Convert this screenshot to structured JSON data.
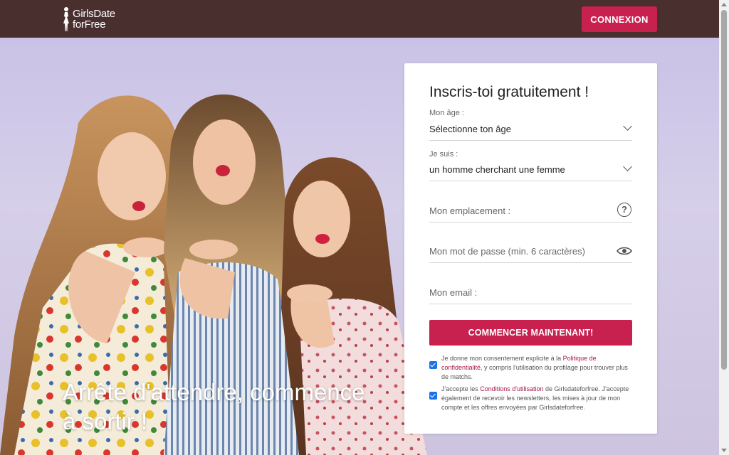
{
  "header": {
    "logo_line1": "GirlsDate",
    "logo_line2": "forFree",
    "login_label": "CONNEXION"
  },
  "hero": {
    "tagline_line1": "Arrête d'attendre, commence",
    "tagline_line2": "à sortir !"
  },
  "form": {
    "title": "Inscris-toi gratuitement !",
    "age": {
      "label": "Mon âge :",
      "value": "Sélectionne ton âge"
    },
    "seeking": {
      "label": "Je suis :",
      "value": "un homme cherchant une femme"
    },
    "location": {
      "placeholder": "Mon emplacement :"
    },
    "password": {
      "placeholder": "Mon mot de passe (min. 6 caractères)"
    },
    "email": {
      "placeholder": "Mon email :"
    },
    "submit_label": "COMMENCER MAINTENANT!",
    "consent1": {
      "checked": true,
      "text_before": "Je donne mon consentement explicite à la ",
      "link": "Politique de confidentialité",
      "text_after": ", y compris l'utilisation du profilage pour trouver plus de matchs."
    },
    "consent2": {
      "checked": true,
      "text_before": "J'accepte les ",
      "link": "Conditions d'utilisation",
      "text_after": " de Girlsdateforfree. J'accepte également de recevoir les newsletters, les mises à jour de mon compte et les offres envoyées par Girlsdateforfree."
    }
  },
  "colors": {
    "header_bg": "#4a2f2f",
    "accent": "#c8214f",
    "checkbox": "#1a73e8"
  },
  "icons": {
    "logo": "woman-silhouette-icon",
    "age_dropdown": "chevron-down-icon",
    "seeking_dropdown": "chevron-down-icon",
    "location_help": "question-circle-icon",
    "password_toggle": "eye-icon"
  }
}
